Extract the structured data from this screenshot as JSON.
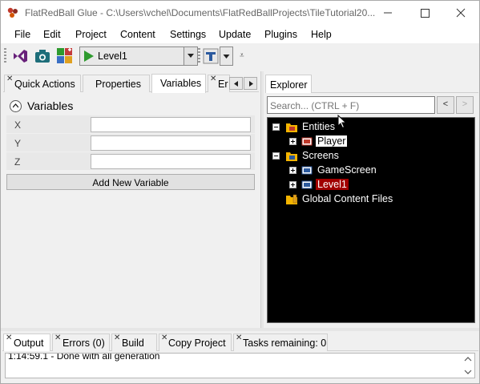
{
  "window": {
    "title": "FlatRedBall Glue - C:\\Users\\vchel\\Documents\\FlatRedBallProjects\\TileTutorial20..."
  },
  "menu": {
    "items": [
      "File",
      "Edit",
      "Project",
      "Content",
      "Settings",
      "Update",
      "Plugins",
      "Help"
    ]
  },
  "toolbar": {
    "screen_select_value": "Level1",
    "overflow_glyph": "⩡"
  },
  "left_tabs": [
    {
      "label": "Quick Actions",
      "closable": true
    },
    {
      "label": "Properties",
      "closable": false
    },
    {
      "label": "Variables",
      "closable": false,
      "active": true
    },
    {
      "label": "Er",
      "closable": true
    }
  ],
  "variables": {
    "title": "Variables",
    "rows": [
      {
        "name": "X",
        "value": ""
      },
      {
        "name": "Y",
        "value": ""
      },
      {
        "name": "Z",
        "value": ""
      }
    ],
    "add_button_label": "Add New Variable"
  },
  "explorer": {
    "tab_label": "Explorer",
    "search_placeholder": "Search... (CTRL + F)",
    "back_label": "<",
    "forward_label": ">",
    "tree": {
      "entities_label": "Entities",
      "player_label": "Player",
      "screens_label": "Screens",
      "gamescreen_label": "GameScreen",
      "level1_label": "Level1",
      "global_content_label": "Global Content Files"
    }
  },
  "bottom_tabs": [
    {
      "label": "Output",
      "active": true
    },
    {
      "label": "Errors (0)",
      "active": false
    },
    {
      "label": "Build",
      "active": false
    },
    {
      "label": "Copy Project",
      "active": false
    },
    {
      "label": "Tasks remaining: 0",
      "active": false
    }
  ],
  "output": {
    "text": "1:14:59.1 - Done with all generation"
  },
  "colors": {
    "tree_background": "#000000",
    "selected_screen": "#a00000",
    "folder": "#f4b400",
    "play_green": "#2e9a2e",
    "vs_purple": "#68217a"
  }
}
